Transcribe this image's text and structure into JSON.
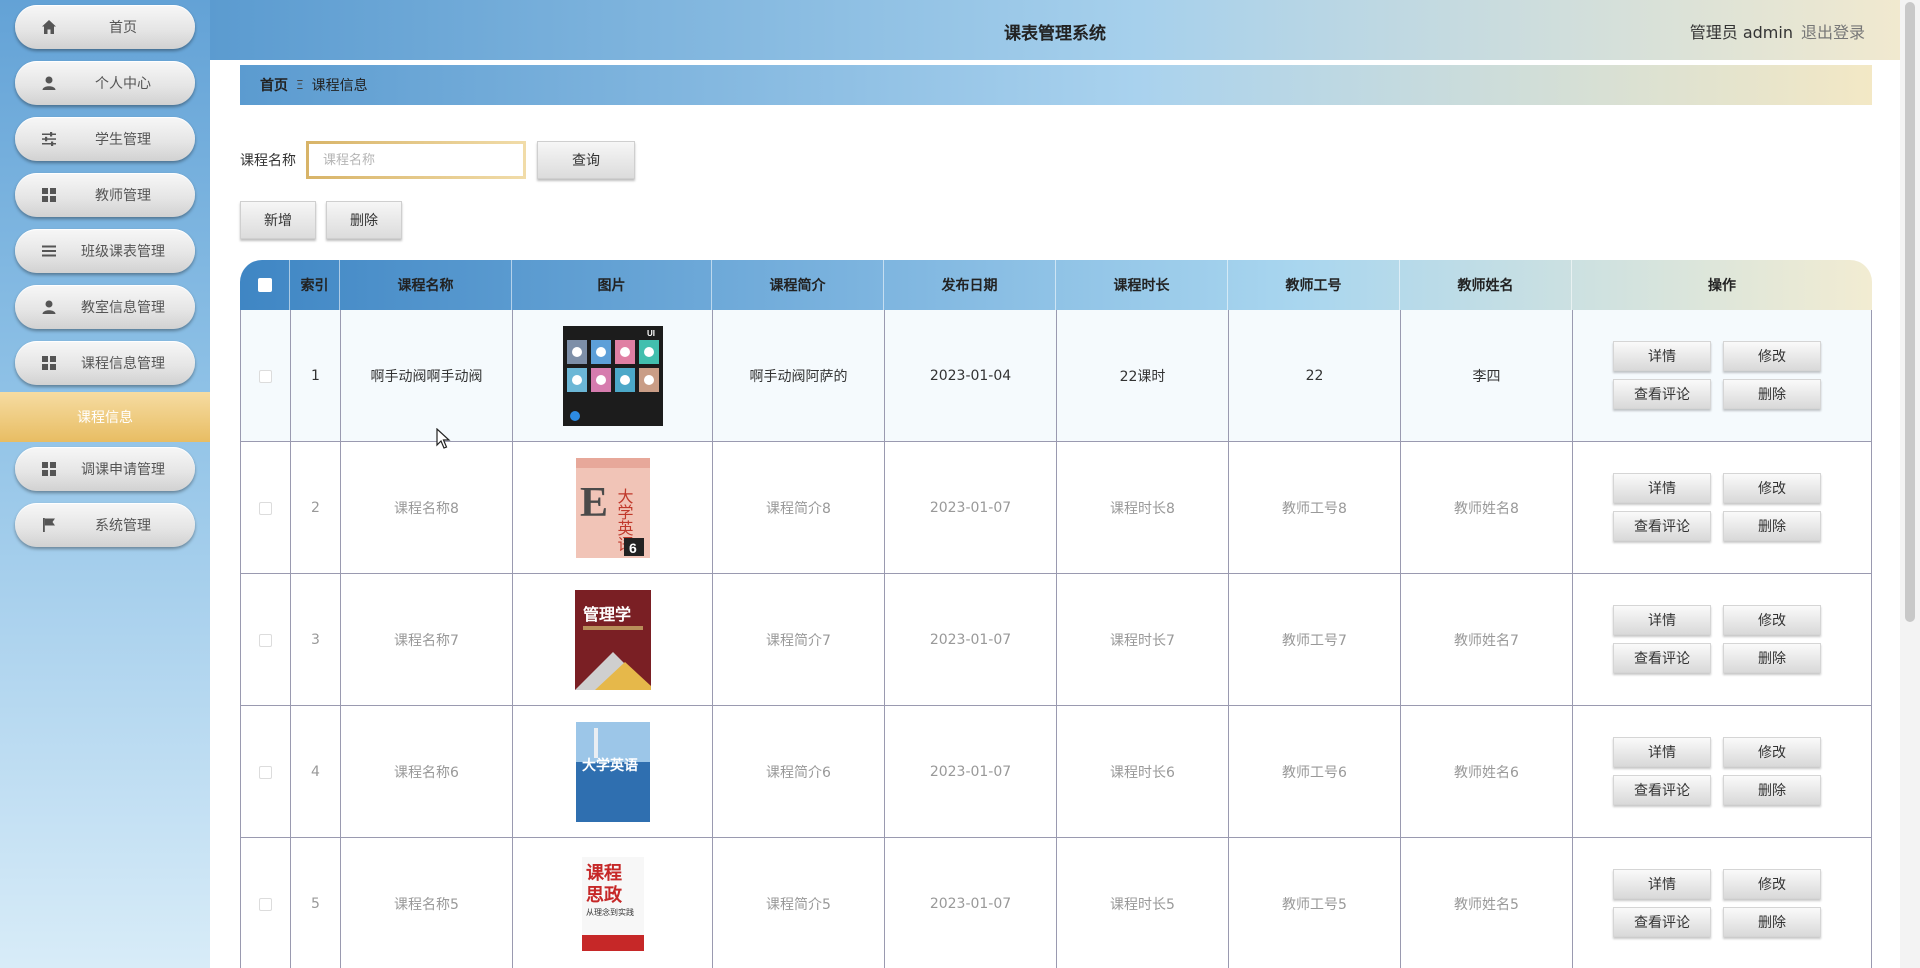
{
  "sidebar": {
    "items": [
      {
        "label": "首页",
        "icon": "home-icon"
      },
      {
        "label": "个人中心",
        "icon": "user-icon"
      },
      {
        "label": "学生管理",
        "icon": "sliders-icon"
      },
      {
        "label": "教师管理",
        "icon": "grid-icon"
      },
      {
        "label": "班级课表管理",
        "icon": "list-icon"
      },
      {
        "label": "教室信息管理",
        "icon": "user-icon"
      },
      {
        "label": "课程信息管理",
        "icon": "grid-icon"
      },
      {
        "label": "调课申请管理",
        "icon": "grid-icon"
      },
      {
        "label": "系统管理",
        "icon": "flag-icon"
      }
    ],
    "active_sub": "课程信息",
    "active_color": "#e8bd63"
  },
  "header": {
    "title": "课表管理系统",
    "user": "管理员 admin",
    "logout": "退出登录"
  },
  "breadcrumb": {
    "home": "首页",
    "separator": "Ξ",
    "current": "课程信息"
  },
  "search": {
    "label": "课程名称",
    "placeholder": "课程名称",
    "value": "",
    "button": "查询"
  },
  "actions": {
    "add": "新增",
    "delete": "删除"
  },
  "table": {
    "columns": [
      "索引",
      "课程名称",
      "图片",
      "课程简介",
      "发布日期",
      "课程时长",
      "教师工号",
      "教师姓名",
      "操作"
    ],
    "rows": [
      {
        "index": "1",
        "name": "啊手动阀啊手动阀",
        "image": "weather-app-cover",
        "intro": "啊手动阀阿萨的",
        "date": "2023-01-04",
        "duration": "22课时",
        "teacher_id": "22",
        "teacher_name": "李四"
      },
      {
        "index": "2",
        "name": "课程名称8",
        "image": "college-english-6-cover",
        "intro": "课程简介8",
        "date": "2023-01-07",
        "duration": "课程时长8",
        "teacher_id": "教师工号8",
        "teacher_name": "教师姓名8"
      },
      {
        "index": "3",
        "name": "课程名称7",
        "image": "management-cover",
        "intro": "课程简介7",
        "date": "2023-01-07",
        "duration": "课程时长7",
        "teacher_id": "教师工号7",
        "teacher_name": "教师姓名7"
      },
      {
        "index": "4",
        "name": "课程名称6",
        "image": "college-english-cover",
        "intro": "课程简介6",
        "date": "2023-01-07",
        "duration": "课程时长6",
        "teacher_id": "教师工号6",
        "teacher_name": "教师姓名6"
      },
      {
        "index": "5",
        "name": "课程名称5",
        "image": "ideology-cover",
        "intro": "课程简介5",
        "date": "2023-01-07",
        "duration": "课程时长5",
        "teacher_id": "教师工号5",
        "teacher_name": "教师姓名5"
      }
    ],
    "row_actions": {
      "detail": "详情",
      "edit": "修改",
      "comments": "查看评论",
      "delete": "删除"
    }
  },
  "cover_texts": {
    "ui_badge": "UI",
    "english_title": "大学英语",
    "english_level": "6",
    "management_title": "管理学",
    "english_title_2": "大学英语",
    "ideology_title_1": "课程",
    "ideology_title_2": "思政",
    "ideology_subtitle": "从理念到实践"
  }
}
